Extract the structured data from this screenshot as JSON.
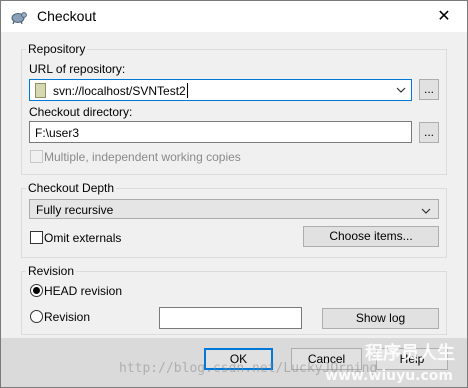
{
  "window": {
    "title": "Checkout",
    "close_glyph": "✕",
    "app_icon": "tortoise-icon"
  },
  "repository": {
    "group_label": "Repository",
    "url_label": "URL of repository:",
    "url_value": "svn://localhost/SVNTest2",
    "checkout_dir_label": "Checkout directory:",
    "checkout_dir_value": "F:\\user3",
    "browse_label": "...",
    "multiple_label": "Multiple, independent working copies",
    "multiple_checked": false,
    "multiple_enabled": false
  },
  "checkout_depth": {
    "group_label": "Checkout Depth",
    "selected": "Fully recursive",
    "omit_externals_label": "Omit externals",
    "omit_externals_checked": false,
    "choose_items_label": "Choose items..."
  },
  "revision": {
    "group_label": "Revision",
    "head_label": "HEAD revision",
    "revision_label": "Revision",
    "selected": "HEAD revision",
    "revision_value": "",
    "show_log_label": "Show log"
  },
  "footer": {
    "ok_label": "OK",
    "cancel_label": "Cancel",
    "help_label": "Help"
  },
  "watermark": {
    "url_text": "http://blog.csdn.net/LuckyJQrning",
    "brand_text": "程序员人生",
    "site_text": "www.wiuyu.com"
  },
  "colors": {
    "accent": "#0078d7",
    "dialog_bg": "#f0f0f0",
    "footer_bg": "#dadada"
  }
}
